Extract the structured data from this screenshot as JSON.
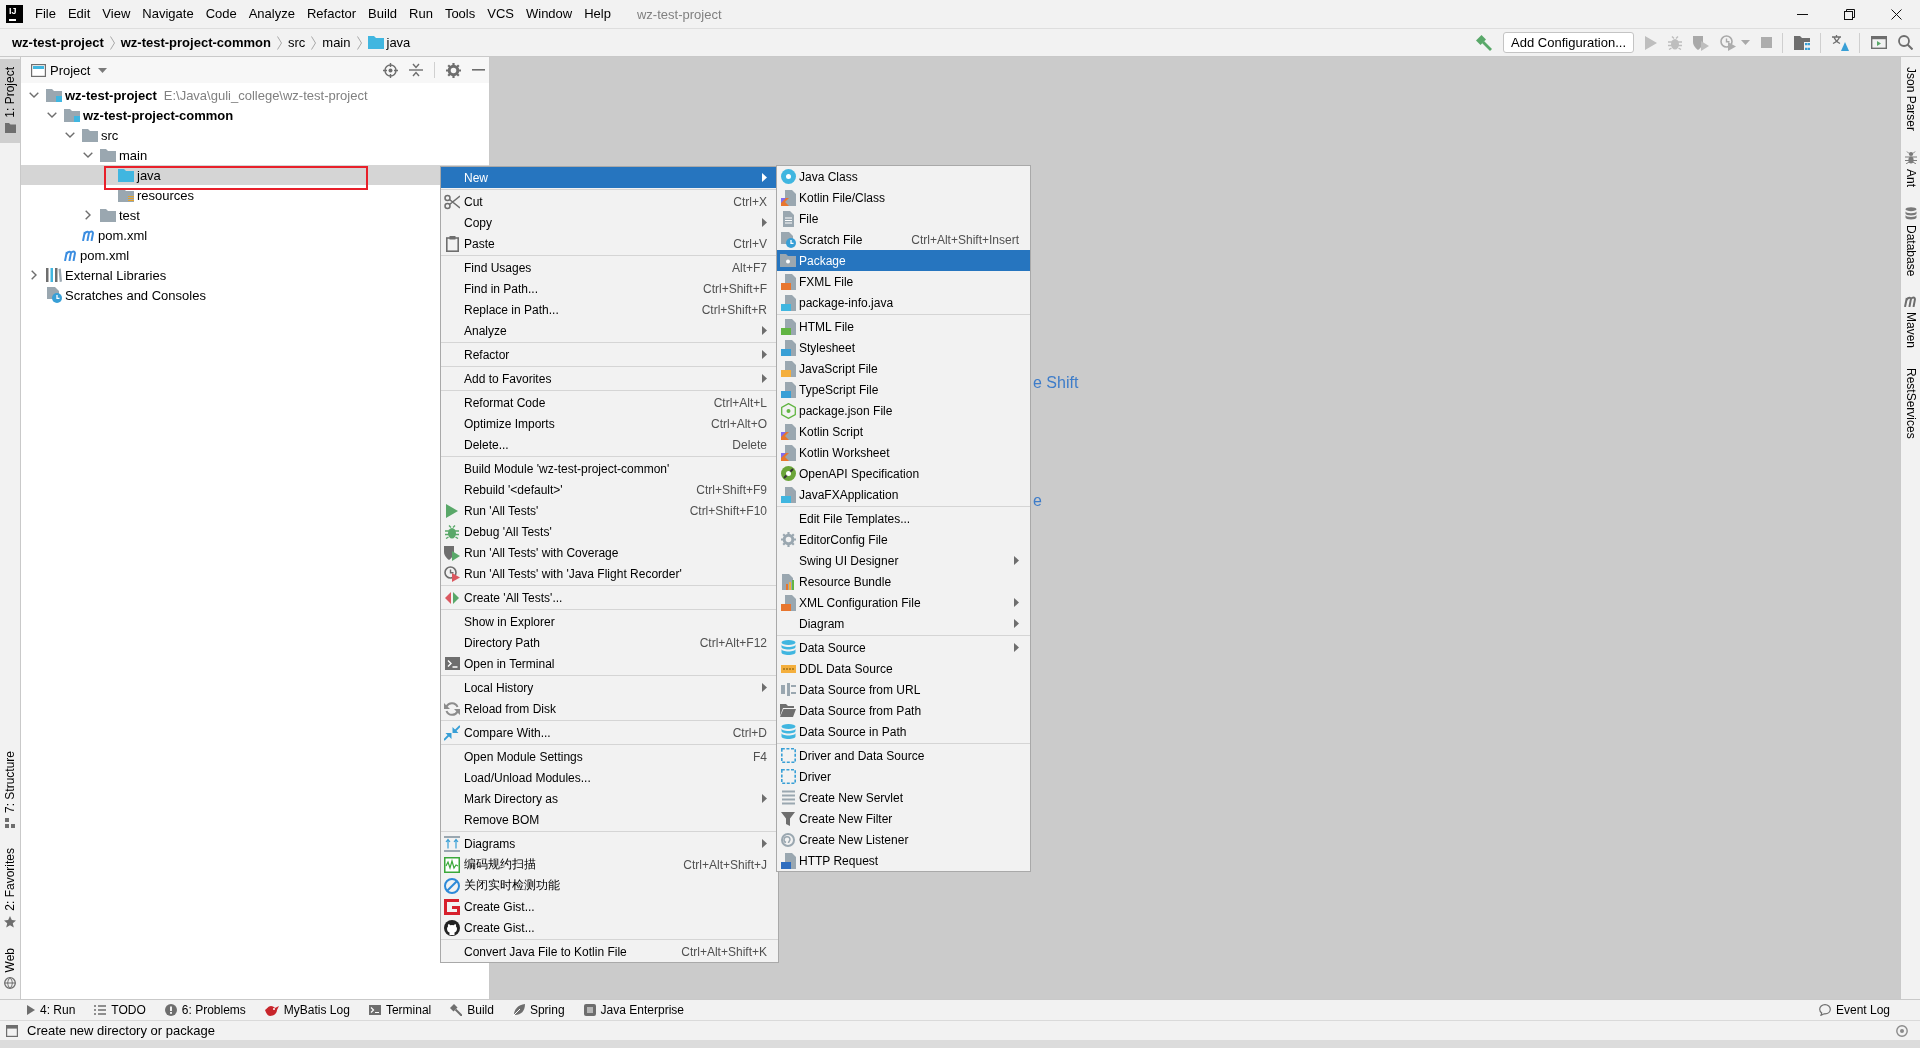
{
  "title_bar": {
    "app_icon": "IJ",
    "menus": [
      "File",
      "Edit",
      "View",
      "Navigate",
      "Code",
      "Analyze",
      "Refactor",
      "Build",
      "Run",
      "Tools",
      "VCS",
      "Window",
      "Help"
    ],
    "title": "wz-test-project"
  },
  "nav_bar": {
    "breadcrumbs": [
      {
        "label": "wz-test-project",
        "kind": "module"
      },
      {
        "label": "wz-test-project-common",
        "kind": "module"
      },
      {
        "label": "src",
        "kind": "folder"
      },
      {
        "label": "main",
        "kind": "folder"
      },
      {
        "label": "java",
        "kind": "source"
      }
    ],
    "toolbar": {
      "leading": [
        {
          "disabled": false
        }
      ],
      "run_configuration": "Add Configuration...",
      "run_actions": [
        {
          "disabled": true
        },
        {
          "disabled": true
        },
        {
          "disabled": true
        },
        {
          "disabled": true
        },
        {
          "disabled": true
        }
      ],
      "trailing": [
        {
          "disabled": false
        },
        {
          "disabled": false
        },
        {
          "disabled": false
        },
        {
          "disabled": false
        }
      ]
    }
  },
  "left_strip": {
    "top": [
      {
        "label": "1: Project",
        "selected": true
      }
    ],
    "bottom": [
      {
        "label": "7: Structure",
        "selected": false
      },
      {
        "label": "2: Favorites",
        "selected": false
      },
      {
        "label": "Web",
        "selected": false
      }
    ]
  },
  "project_panel": {
    "title": "Project",
    "tree": [
      {
        "name": "wz-test-project",
        "kind": "module",
        "path": "E:\\Java\\guli_college\\wz-test-project",
        "expanded": true,
        "selected": false,
        "annotated": false,
        "children": [
          {
            "name": "wz-test-project-common",
            "kind": "module",
            "expanded": true,
            "selected": false,
            "annotated": false,
            "children": [
              {
                "name": "src",
                "kind": "folder",
                "expanded": true,
                "selected": false,
                "annotated": false,
                "children": [
                  {
                    "name": "main",
                    "kind": "folder",
                    "expanded": true,
                    "selected": false,
                    "annotated": false,
                    "children": [
                      {
                        "name": "java",
                        "kind": "source",
                        "selected": true,
                        "annotated": true
                      },
                      {
                        "name": "resources",
                        "kind": "resources",
                        "selected": false,
                        "annotated": false
                      }
                    ]
                  },
                  {
                    "name": "test",
                    "kind": "folder",
                    "expanded": false,
                    "selected": false,
                    "annotated": false
                  }
                ]
              },
              {
                "name": "pom.xml",
                "kind": "maven",
                "selected": false,
                "annotated": false
              }
            ]
          },
          {
            "name": "pom.xml",
            "kind": "maven",
            "selected": false,
            "annotated": false
          }
        ]
      },
      {
        "name": "External Libraries",
        "kind": "libraries",
        "expanded": false,
        "selected": false,
        "annotated": false
      },
      {
        "name": "Scratches and Consoles",
        "kind": "scratches",
        "selected": false,
        "annotated": false
      }
    ]
  },
  "editor": {
    "hints": [
      "e Shift",
      "e"
    ]
  },
  "right_strip": [
    {
      "label": "Json Parser",
      "selected": false
    },
    {
      "label": "Ant",
      "selected": false
    },
    {
      "label": "Database",
      "selected": false
    },
    {
      "label": "Maven",
      "selected": false
    },
    {
      "label": "RestServices",
      "selected": false
    }
  ],
  "context_menu": {
    "groups": [
      [
        {
          "label": "New",
          "submenu": true,
          "selected": true
        }
      ],
      [
        {
          "label": "Cut",
          "shortcut": "Ctrl+X",
          "submenu": false,
          "selected": false
        },
        {
          "label": "Copy",
          "submenu": true,
          "selected": false
        },
        {
          "label": "Paste",
          "shortcut": "Ctrl+V",
          "submenu": false,
          "selected": false
        }
      ],
      [
        {
          "label": "Find Usages",
          "shortcut": "Alt+F7",
          "submenu": false,
          "selected": false
        },
        {
          "label": "Find in Path...",
          "shortcut": "Ctrl+Shift+F",
          "submenu": false,
          "selected": false
        },
        {
          "label": "Replace in Path...",
          "shortcut": "Ctrl+Shift+R",
          "submenu": false,
          "selected": false
        },
        {
          "label": "Analyze",
          "submenu": true,
          "selected": false
        }
      ],
      [
        {
          "label": "Refactor",
          "submenu": true,
          "selected": false
        }
      ],
      [
        {
          "label": "Add to Favorites",
          "submenu": true,
          "selected": false
        }
      ],
      [
        {
          "label": "Reformat Code",
          "shortcut": "Ctrl+Alt+L",
          "submenu": false,
          "selected": false
        },
        {
          "label": "Optimize Imports",
          "shortcut": "Ctrl+Alt+O",
          "submenu": false,
          "selected": false
        },
        {
          "label": "Delete...",
          "shortcut": "Delete",
          "submenu": false,
          "selected": false
        }
      ],
      [
        {
          "label": "Build Module 'wz-test-project-common'",
          "submenu": false,
          "selected": false
        },
        {
          "label": "Rebuild '<default>'",
          "shortcut": "Ctrl+Shift+F9",
          "submenu": false,
          "selected": false
        },
        {
          "label": "Run 'All Tests'",
          "shortcut": "Ctrl+Shift+F10",
          "submenu": false,
          "selected": false
        },
        {
          "label": "Debug 'All Tests'",
          "submenu": false,
          "selected": false
        },
        {
          "label": "Run 'All Tests' with Coverage",
          "submenu": false,
          "selected": false
        },
        {
          "label": "Run 'All Tests' with 'Java Flight Recorder'",
          "submenu": false,
          "selected": false
        }
      ],
      [
        {
          "label": "Create 'All Tests'...",
          "submenu": false,
          "selected": false
        }
      ],
      [
        {
          "label": "Show in Explorer",
          "submenu": false,
          "selected": false
        },
        {
          "label": "Directory Path",
          "shortcut": "Ctrl+Alt+F12",
          "submenu": false,
          "selected": false
        },
        {
          "label": "Open in Terminal",
          "submenu": false,
          "selected": false
        }
      ],
      [
        {
          "label": "Local History",
          "submenu": true,
          "selected": false
        },
        {
          "label": "Reload from Disk",
          "submenu": false,
          "selected": false
        }
      ],
      [
        {
          "label": "Compare With...",
          "shortcut": "Ctrl+D",
          "submenu": false,
          "selected": false
        }
      ],
      [
        {
          "label": "Open Module Settings",
          "shortcut": "F4",
          "submenu": false,
          "selected": false
        },
        {
          "label": "Load/Unload Modules...",
          "submenu": false,
          "selected": false
        },
        {
          "label": "Mark Directory as",
          "submenu": true,
          "selected": false
        },
        {
          "label": "Remove BOM",
          "submenu": false,
          "selected": false
        }
      ],
      [
        {
          "label": "Diagrams",
          "submenu": true,
          "selected": false
        },
        {
          "label": "编码规约扫描",
          "shortcut": "Ctrl+Alt+Shift+J",
          "submenu": false,
          "selected": false
        },
        {
          "label": "关闭实时检测功能",
          "submenu": false,
          "selected": false
        },
        {
          "label": "Create Gist...",
          "submenu": false,
          "selected": false
        },
        {
          "label": "Create Gist...",
          "submenu": false,
          "selected": false
        }
      ],
      [
        {
          "label": "Convert Java File to Kotlin File",
          "shortcut": "Ctrl+Alt+Shift+K",
          "submenu": false,
          "selected": false
        }
      ]
    ]
  },
  "new_submenu": {
    "groups": [
      [
        {
          "label": "Java Class",
          "submenu": false,
          "selected": false
        },
        {
          "label": "Kotlin File/Class",
          "submenu": false,
          "selected": false
        },
        {
          "label": "File",
          "submenu": false,
          "selected": false
        },
        {
          "label": "Scratch File",
          "shortcut": "Ctrl+Alt+Shift+Insert",
          "submenu": false,
          "selected": false
        },
        {
          "label": "Package",
          "submenu": false,
          "selected": true
        },
        {
          "label": "FXML File",
          "submenu": false,
          "selected": false
        },
        {
          "label": "package-info.java",
          "submenu": false,
          "selected": false
        }
      ],
      [
        {
          "label": "HTML File",
          "submenu": false,
          "selected": false
        },
        {
          "label": "Stylesheet",
          "submenu": false,
          "selected": false
        },
        {
          "label": "JavaScript File",
          "submenu": false,
          "selected": false
        },
        {
          "label": "TypeScript File",
          "submenu": false,
          "selected": false
        },
        {
          "label": "package.json File",
          "submenu": false,
          "selected": false
        },
        {
          "label": "Kotlin Script",
          "submenu": false,
          "selected": false
        },
        {
          "label": "Kotlin Worksheet",
          "submenu": false,
          "selected": false
        },
        {
          "label": "OpenAPI Specification",
          "submenu": false,
          "selected": false
        },
        {
          "label": "JavaFXApplication",
          "submenu": false,
          "selected": false
        }
      ],
      [
        {
          "label": "Edit File Templates...",
          "submenu": false,
          "selected": false
        },
        {
          "label": "EditorConfig File",
          "submenu": false,
          "selected": false
        },
        {
          "label": "Swing UI Designer",
          "submenu": true,
          "selected": false
        },
        {
          "label": "Resource Bundle",
          "submenu": false,
          "selected": false
        },
        {
          "label": "XML Configuration File",
          "submenu": true,
          "selected": false
        },
        {
          "label": "Diagram",
          "submenu": true,
          "selected": false
        }
      ],
      [
        {
          "label": "Data Source",
          "submenu": true,
          "selected": false
        },
        {
          "label": "DDL Data Source",
          "submenu": false,
          "selected": false
        },
        {
          "label": "Data Source from URL",
          "submenu": false,
          "selected": false
        },
        {
          "label": "Data Source from Path",
          "submenu": false,
          "selected": false
        },
        {
          "label": "Data Source in Path",
          "submenu": false,
          "selected": false
        }
      ],
      [
        {
          "label": "Driver and Data Source",
          "submenu": false,
          "selected": false
        },
        {
          "label": "Driver",
          "submenu": false,
          "selected": false
        },
        {
          "label": "Create New Servlet",
          "submenu": false,
          "selected": false
        },
        {
          "label": "Create New Filter",
          "submenu": false,
          "selected": false
        },
        {
          "label": "Create New Listener",
          "submenu": false,
          "selected": false
        },
        {
          "label": "HTTP Request",
          "submenu": false,
          "selected": false
        }
      ]
    ]
  },
  "tool_buttons": [
    {
      "label": "4: Run",
      "selected": false
    },
    {
      "label": "TODO",
      "selected": false
    },
    {
      "label": "6: Problems",
      "selected": false
    },
    {
      "label": "MyBatis Log",
      "selected": false
    },
    {
      "label": "Terminal",
      "selected": false
    },
    {
      "label": "Build",
      "selected": false
    },
    {
      "label": "Spring",
      "selected": false
    },
    {
      "label": "Java Enterprise",
      "selected": false
    }
  ],
  "event_log": {
    "label": "Event Log",
    "selected": false
  },
  "status_bar": {
    "message": "Create new directory or package"
  }
}
